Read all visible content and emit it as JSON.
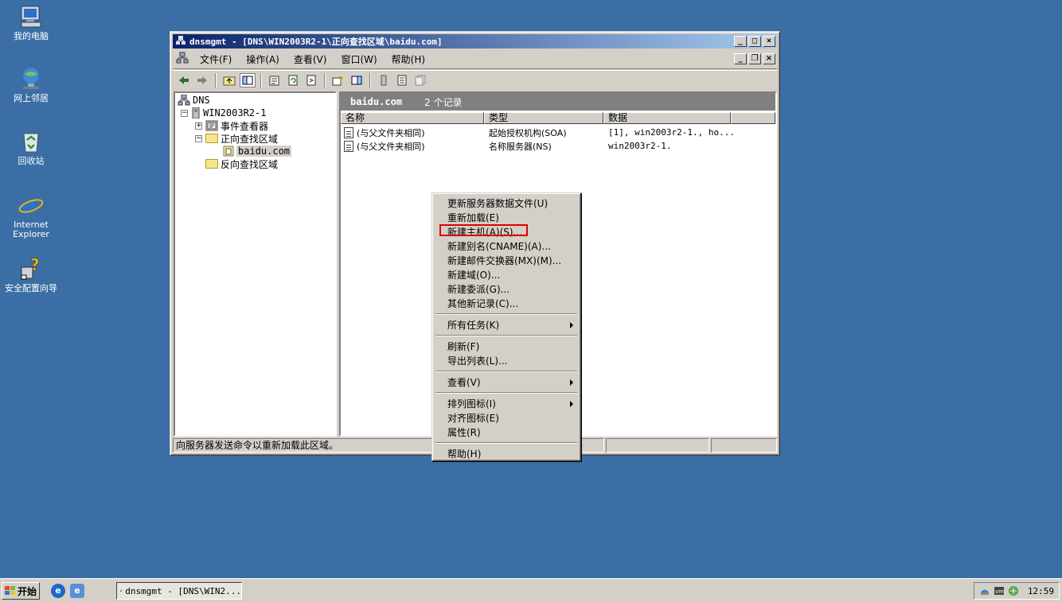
{
  "desktop": {
    "icons": [
      {
        "label": "我的电脑"
      },
      {
        "label": "网上邻居"
      },
      {
        "label": "回收站"
      },
      {
        "label": "Internet Explorer"
      },
      {
        "label": "安全配置向导"
      }
    ]
  },
  "window": {
    "title": "dnsmgmt - [DNS\\WIN2003R2-1\\正向查找区域\\baidu.com]",
    "caption_buttons": {
      "minimize": "_",
      "maximize": "□",
      "close": "×"
    },
    "menu": [
      "文件(F)",
      "操作(A)",
      "查看(V)",
      "窗口(W)",
      "帮助(H)"
    ],
    "mdi_buttons": {
      "minimize": "_",
      "restore": "❐",
      "close": "×"
    }
  },
  "tree": {
    "root": "DNS",
    "server": "WIN2003R2-1",
    "expand_plus": "+",
    "expand_minus": "−",
    "nodes": [
      {
        "label": "事件查看器"
      },
      {
        "label": "正向查找区域"
      },
      {
        "label": "baidu.com"
      },
      {
        "label": "反向查找区域"
      }
    ]
  },
  "details": {
    "zone": "baidu.com",
    "record_count": "2 个记录",
    "columns": [
      "名称",
      "类型",
      "数据",
      ""
    ],
    "rows": [
      {
        "name": "(与父文件夹相同)",
        "type": "起始授权机构(SOA)",
        "data": "[1], win2003r2-1., ho..."
      },
      {
        "name": "(与父文件夹相同)",
        "type": "名称服务器(NS)",
        "data": "win2003r2-1."
      }
    ]
  },
  "status": {
    "message": "向服务器发送命令以重新加载此区域。"
  },
  "context_menu": {
    "groups": [
      [
        {
          "label": "更新服务器数据文件(U)"
        },
        {
          "label": "重新加载(E)"
        },
        {
          "label": "新建主机(A)(S)...",
          "highlighted": true
        },
        {
          "label": "新建别名(CNAME)(A)..."
        },
        {
          "label": "新建邮件交换器(MX)(M)..."
        },
        {
          "label": "新建域(O)..."
        },
        {
          "label": "新建委派(G)..."
        },
        {
          "label": "其他新记录(C)..."
        }
      ],
      [
        {
          "label": "所有任务(K)",
          "submenu": true
        }
      ],
      [
        {
          "label": "刷新(F)"
        },
        {
          "label": "导出列表(L)..."
        }
      ],
      [
        {
          "label": "查看(V)",
          "submenu": true
        }
      ],
      [
        {
          "label": "排列图标(I)",
          "submenu": true
        },
        {
          "label": "对齐图标(E)"
        },
        {
          "label": "属性(R)"
        }
      ],
      [
        {
          "label": "帮助(H)"
        }
      ]
    ],
    "highlight_color": "#e00000"
  },
  "taskbar": {
    "start_label": "开始",
    "task_label": "dnsmgmt - [DNS\\WIN2...",
    "clock": "12:59"
  },
  "colors": {
    "desktop": "#3a6ea5",
    "titlebar_start": "#0a246a",
    "titlebar_end": "#a6caf0",
    "face": "#d4d0c8"
  }
}
